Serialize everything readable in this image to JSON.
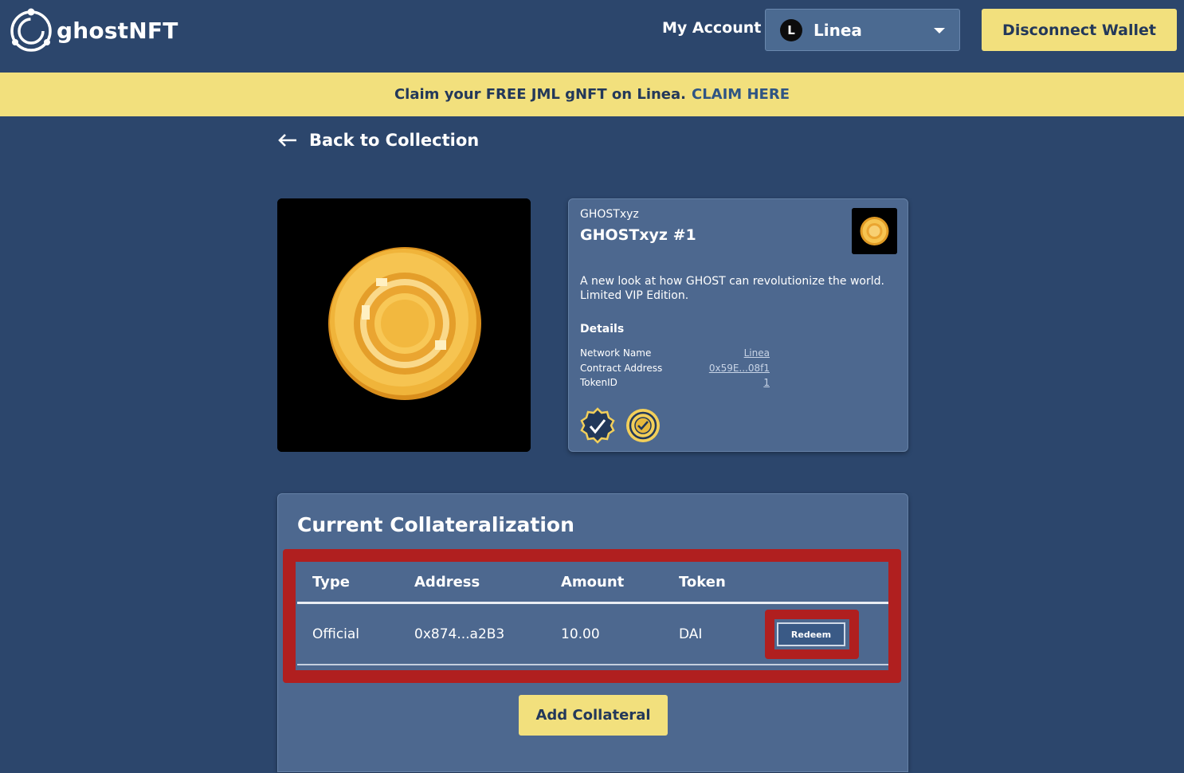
{
  "header": {
    "logo_text": "ghostNFT",
    "my_account": "My Account",
    "network": {
      "label": "Linea",
      "icon_letter": "L"
    },
    "disconnect_label": "Disconnect Wallet"
  },
  "banner": {
    "text": "Claim your FREE JML gNFT on Linea.",
    "link_text": "CLAIM HERE"
  },
  "back": {
    "label": "Back to Collection"
  },
  "nft": {
    "collection": "GHOSTxyz",
    "title": "GHOSTxyz #1",
    "description": "A new look at how GHOST can revolutionize the world. Limited VIP Edition.",
    "details_title": "Details",
    "details": [
      {
        "label": "Network Name",
        "value": "Linea"
      },
      {
        "label": "Contract Address",
        "value": "0x59E...08f1"
      },
      {
        "label": "TokenID",
        "value": "1"
      }
    ],
    "badges": [
      "verified-badge-icon",
      "ghost-coin-badge-icon"
    ]
  },
  "collateral": {
    "title": "Current Collateralization",
    "columns": [
      "Type",
      "Address",
      "Amount",
      "Token"
    ],
    "rows": [
      {
        "type": "Official",
        "address": "0x874...a2B3",
        "amount": "10.00",
        "token": "DAI",
        "action": "Redeem"
      }
    ],
    "add_label": "Add Collateral"
  },
  "colors": {
    "background": "#2c466c",
    "card": "#4d688f",
    "accent_yellow": "#f2e07d",
    "highlight_red": "#b01f1f"
  }
}
